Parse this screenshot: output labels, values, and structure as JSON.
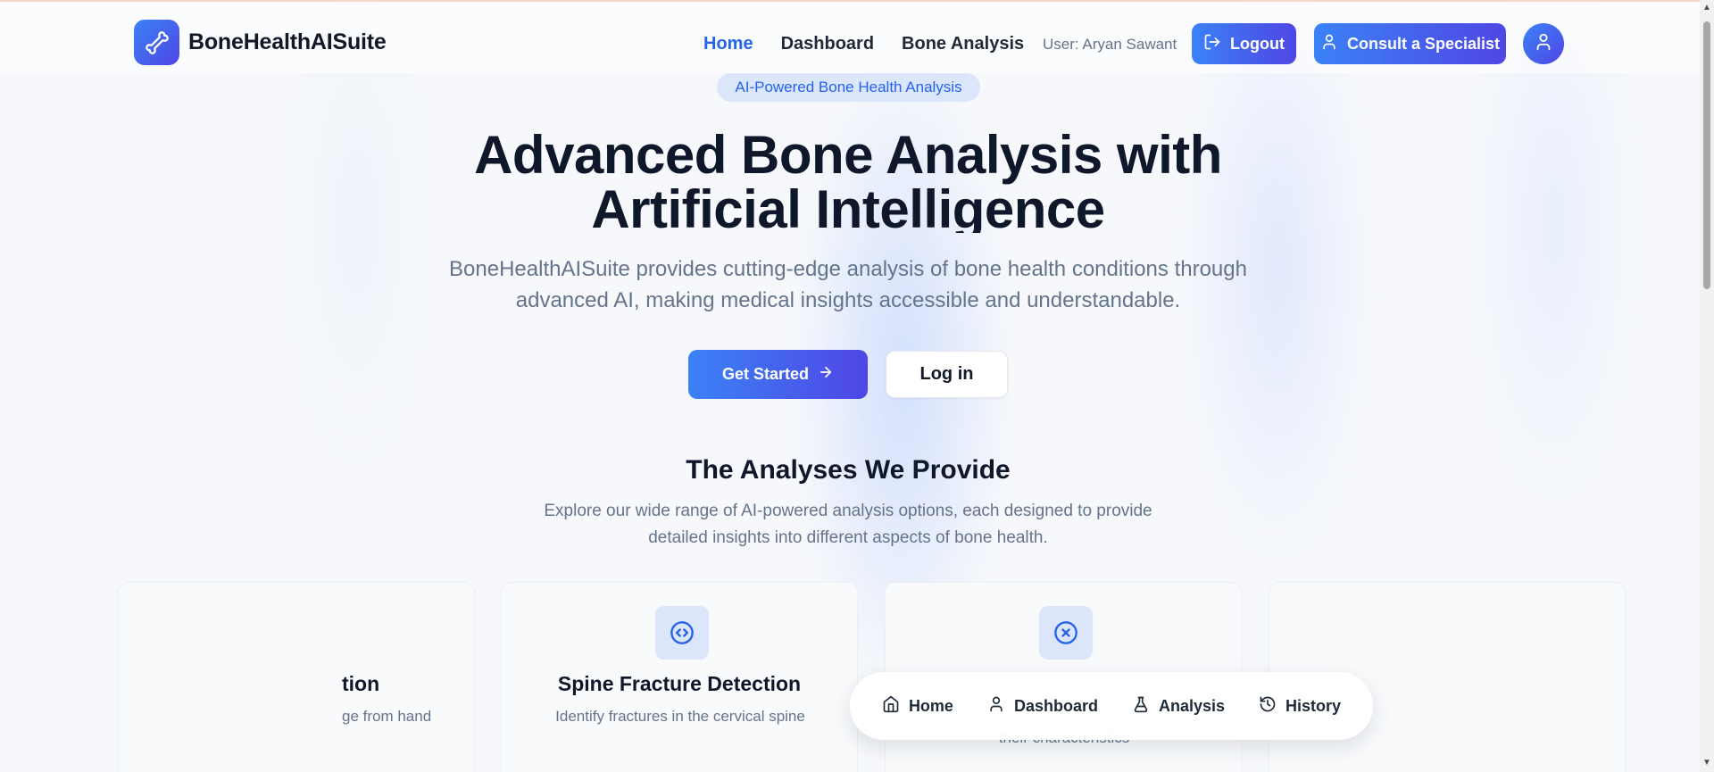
{
  "header": {
    "brand_name": "BoneHealthAISuite",
    "nav_links": [
      "Home",
      "Dashboard",
      "Bone Analysis"
    ],
    "active_link": "Home",
    "user_text": "User: Aryan Sawant",
    "logout_label": "Logout",
    "consult_label": "Consult a Specialist"
  },
  "hero": {
    "badge": "AI-Powered Bone Health Analysis",
    "title_line1": "Advanced Bone Analysis with",
    "title_line2": "Artificial Intelligence",
    "subtitle": "BoneHealthAISuite provides cutting-edge analysis of bone health conditions through advanced AI, making medical insights accessible and understandable.",
    "get_started_label": "Get Started",
    "login_label": "Log in"
  },
  "analyses": {
    "title": "The Analyses We Provide",
    "subtitle": "Explore our wide range of AI-powered analysis options, each designed to provide detailed insights into different aspects of bone health.",
    "cards": [
      {
        "title": "tion",
        "desc": "ge from hand",
        "icon": "none"
      },
      {
        "title": "Spine Fracture Detection",
        "desc": "Identify fractures in the cervical spine",
        "icon": "code-circle-icon"
      },
      {
        "title": "",
        "desc": "their characteristics",
        "icon": "x-circle-icon"
      }
    ]
  },
  "bottom_nav": {
    "items": [
      {
        "label": "Home",
        "icon": "home-icon"
      },
      {
        "label": "Dashboard",
        "icon": "user-icon"
      },
      {
        "label": "Analysis",
        "icon": "flask-icon"
      },
      {
        "label": "History",
        "icon": "history-icon"
      }
    ]
  },
  "colors": {
    "accent": "#3b82f6",
    "accent_end": "#4f46e5",
    "text_dark": "#0f172a",
    "text_muted": "#64748b",
    "badge_bg": "#dbe6fb"
  }
}
